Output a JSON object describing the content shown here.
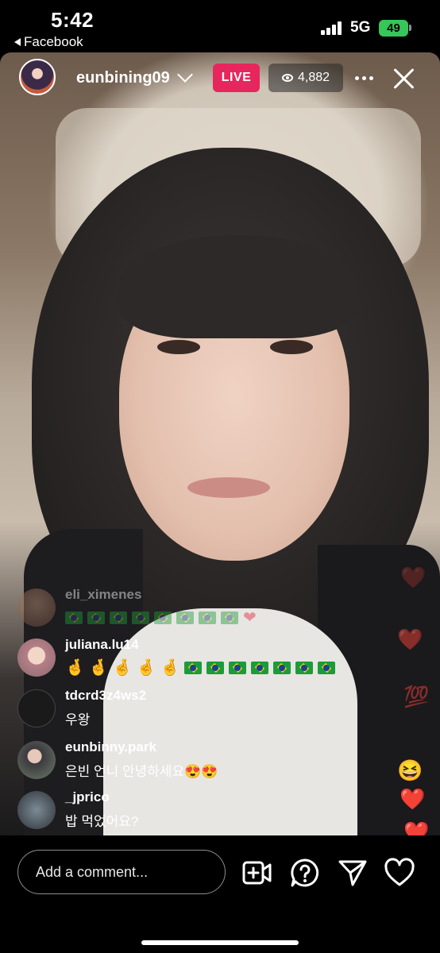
{
  "status_bar": {
    "time": "5:42",
    "back_app": "Facebook",
    "network": "5G",
    "battery": "49"
  },
  "header": {
    "username": "eunbining09",
    "live_label": "LIVE",
    "viewer_count": "4,882"
  },
  "comments": [
    {
      "user": "eli_ximenes",
      "text_type": "flags",
      "flag_count": 8,
      "trailing": "❤️"
    },
    {
      "user": "juliana.lu14",
      "text_type": "hands_flags",
      "hand_count": 5,
      "flag_count": 7
    },
    {
      "user": "tdcrd3z4ws2",
      "text": "우왕"
    },
    {
      "user": "eunbinny.park",
      "text": "은빈 언니 안녕하세요😍😍"
    },
    {
      "user": "_jprico",
      "text": "밥 먹었어요?"
    }
  ],
  "reactions": [
    "❤️",
    "❤️",
    "💯",
    "😆",
    "❤️",
    "❤️"
  ],
  "bottom_bar": {
    "comment_placeholder": "Add a comment...",
    "icons": [
      "add-video-icon",
      "question-icon",
      "send-icon",
      "heart-icon"
    ]
  },
  "colors": {
    "live_badge": "#e8265e",
    "battery": "#35c759"
  }
}
